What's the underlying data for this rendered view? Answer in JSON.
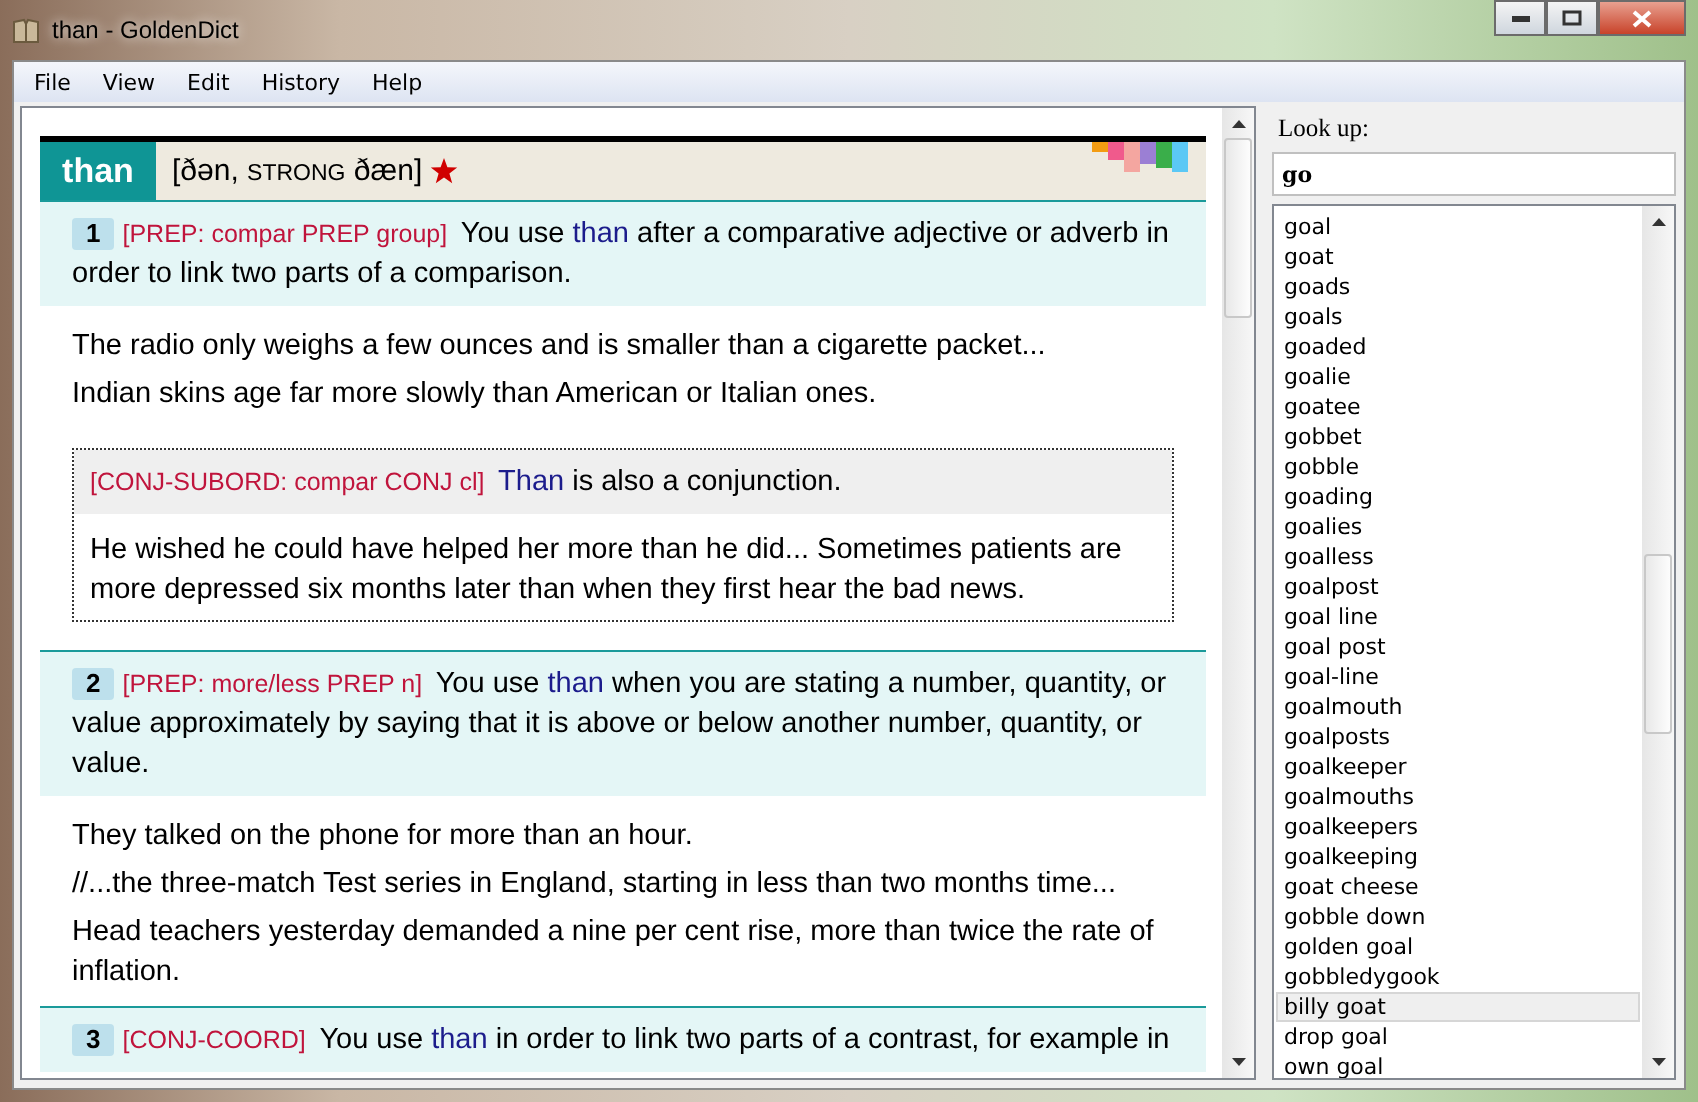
{
  "window": {
    "title": "than - GoldenDict"
  },
  "menu": [
    "File",
    "View",
    "Edit",
    "History",
    "Help"
  ],
  "article": {
    "headword": "than",
    "pronunciation": [
      {
        "text": "[ðən,",
        "kind": "ipa"
      },
      {
        "text": "STRONG",
        "kind": "label"
      },
      {
        "text": "ðæn]",
        "kind": "ipa"
      }
    ],
    "senses": [
      {
        "number": "1",
        "grammar": "[PREP: compar PREP group]",
        "definition": [
          {
            "text": "You use ",
            "kind": "plain"
          },
          {
            "text": "than",
            "kind": "keyword"
          },
          {
            "text": " after a comparative adjective or adverb in order to link two parts of a comparison.",
            "kind": "plain"
          }
        ],
        "examples": [
          "The radio only weighs a few ounces and is smaller than a cigarette packet...",
          "Indian skins age far more slowly than American or Italian ones."
        ],
        "subsense": {
          "grammar": "[CONJ-SUBORD: compar CONJ cl]",
          "definition": [
            {
              "text": "Than",
              "kind": "keyword"
            },
            {
              "text": " is also a conjunction.",
              "kind": "plain"
            }
          ],
          "examples": [
            "He wished he could have helped her more than he did... Sometimes patients are more depressed six months later than when they first hear the bad news."
          ]
        }
      },
      {
        "number": "2",
        "grammar": "[PREP: more/less PREP n]",
        "definition": [
          {
            "text": "You use ",
            "kind": "plain"
          },
          {
            "text": "than",
            "kind": "keyword"
          },
          {
            "text": " when you are stating a number, quantity, or value approximately by saying that it is above or below another number, quantity, or value.",
            "kind": "plain"
          }
        ],
        "examples": [
          "They talked on the phone for more than an hour.",
          "//...the three-match Test series in England, starting in less than two months time...",
          "Head teachers yesterday demanded a nine per cent rise, more than twice the rate of inflation."
        ]
      },
      {
        "number": "3",
        "grammar": "[CONJ-COORD]",
        "definition": [
          {
            "text": "You use ",
            "kind": "plain"
          },
          {
            "text": "than",
            "kind": "keyword"
          },
          {
            "text": " in order to link two parts of a contrast, for example in",
            "kind": "plain"
          }
        ]
      }
    ]
  },
  "lookup": {
    "label": "Look up:",
    "value": "go"
  },
  "words": [
    {
      "text": "goal",
      "selected": false
    },
    {
      "text": "goat",
      "selected": false
    },
    {
      "text": "goads",
      "selected": false
    },
    {
      "text": "goals",
      "selected": false
    },
    {
      "text": "goaded",
      "selected": false
    },
    {
      "text": "goalie",
      "selected": false
    },
    {
      "text": "goatee",
      "selected": false
    },
    {
      "text": "gobbet",
      "selected": false
    },
    {
      "text": "gobble",
      "selected": false
    },
    {
      "text": "goading",
      "selected": false
    },
    {
      "text": "goalies",
      "selected": false
    },
    {
      "text": "goalless",
      "selected": false
    },
    {
      "text": "goalpost",
      "selected": false
    },
    {
      "text": "goal line",
      "selected": false
    },
    {
      "text": "goal post",
      "selected": false
    },
    {
      "text": "goal-line",
      "selected": false
    },
    {
      "text": "goalmouth",
      "selected": false
    },
    {
      "text": "goalposts",
      "selected": false
    },
    {
      "text": "goalkeeper",
      "selected": false
    },
    {
      "text": "goalmouths",
      "selected": false
    },
    {
      "text": "goalkeepers",
      "selected": false
    },
    {
      "text": "goalkeeping",
      "selected": false
    },
    {
      "text": "goat cheese",
      "selected": false
    },
    {
      "text": "gobble down",
      "selected": false
    },
    {
      "text": "golden goal",
      "selected": false
    },
    {
      "text": "gobbledygook",
      "selected": false
    },
    {
      "text": "billy goat",
      "selected": true
    },
    {
      "text": "drop goal",
      "selected": false
    },
    {
      "text": "own goal",
      "selected": false
    }
  ]
}
